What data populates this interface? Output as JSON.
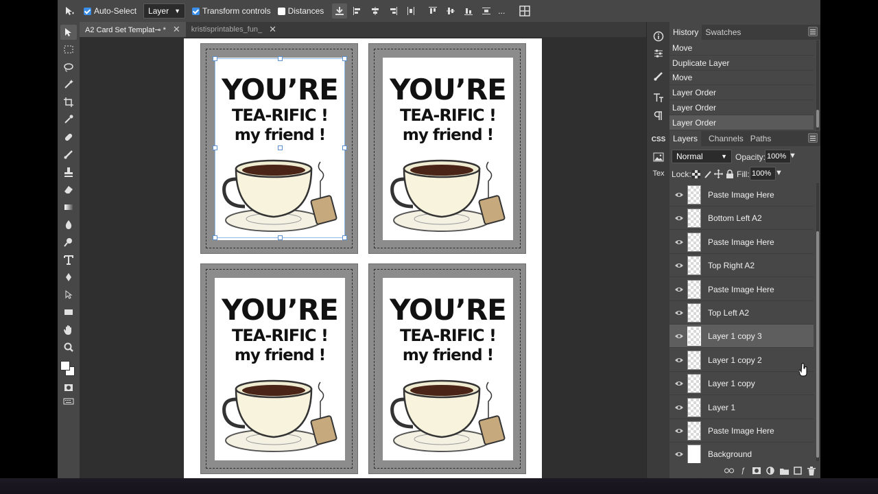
{
  "options_bar": {
    "auto_select_label": "Auto-Select",
    "auto_select_checked": true,
    "target_value": "Layer",
    "transform_controls_label": "Transform controls",
    "transform_controls_checked": true,
    "distances_label": "Distances",
    "distances_checked": false,
    "more_label": "..."
  },
  "tabs": [
    {
      "label": "A2 Card Set Templat⊸ *",
      "active": true
    },
    {
      "label": "kristisprintables_fun_",
      "active": false
    }
  ],
  "card_text": {
    "line1": "YOU’RE",
    "line2": "TEA-RIFIC !",
    "line3": "my friend !"
  },
  "side_strip": {
    "css_label": "CSS",
    "tex_label": "Tex"
  },
  "history": {
    "tabs": [
      "History",
      "Swatches"
    ],
    "items": [
      "Move",
      "Duplicate Layer",
      "Move",
      "Layer Order",
      "Layer Order",
      "Layer Order"
    ]
  },
  "layers_panel": {
    "tabs": [
      "Layers",
      "Channels",
      "Paths"
    ],
    "blend_mode": "Normal",
    "opacity_label": "Opacity:",
    "opacity_value": "100%",
    "lock_label": "Lock:",
    "fill_label": "Fill:",
    "fill_value": "100%",
    "layers": [
      "Paste Image Here",
      "Bottom Left A2",
      "Paste Image Here",
      "Top Right A2",
      "Paste Image Here",
      "Top Left A2",
      "Layer 1 copy 3",
      "Layer 1 copy 2",
      "Layer 1 copy",
      "Layer 1",
      "Paste Image Here",
      "Background"
    ],
    "selected_layer": "Layer 1 copy 3",
    "footer_icons": [
      "link-icon",
      "effects-icon",
      "mask-icon",
      "adjustment-icon",
      "folder-icon",
      "new-layer-icon",
      "trash-icon"
    ]
  },
  "colors": {
    "accent": "#3b8ee8",
    "panel_bg": "#474747",
    "canvas_bg": "#2f2f2f"
  }
}
